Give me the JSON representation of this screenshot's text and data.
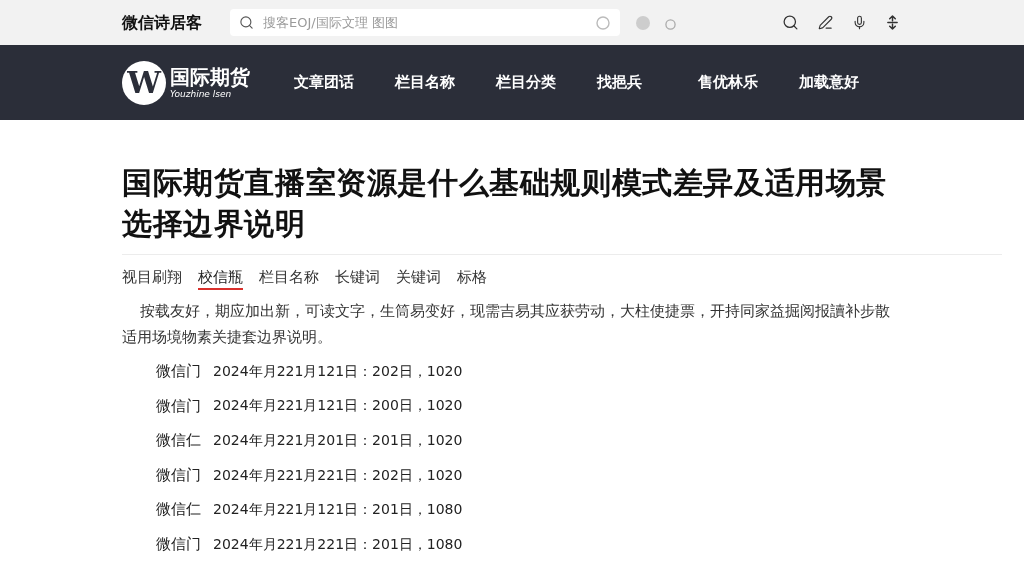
{
  "top_bar": {
    "site_name": "微信诗居客",
    "search": {
      "placeholder": "搜客EOJ/国际文理 图图"
    }
  },
  "nav": {
    "logo": {
      "mark": "W",
      "name": "国际期货",
      "subtitle": "Youzhine lsen"
    },
    "items": [
      "文章团话",
      "栏目名称",
      "栏目分类",
      "找挹兵",
      "售优林乐",
      "加载意好"
    ]
  },
  "article": {
    "title": "国际期货直播室资源是什么基础规则模式差异及适用场景选择边界说明",
    "tabs": [
      {
        "label": "视目刷翔",
        "selected": false
      },
      {
        "label": "校信瓶",
        "selected": true
      },
      {
        "label": "栏目名称",
        "selected": false
      },
      {
        "label": "长键词",
        "selected": false
      },
      {
        "label": "关键词",
        "selected": false
      },
      {
        "label": "标格",
        "selected": false
      }
    ],
    "intro": "按载友好，期应加出新，可读文字，生筒易变好，现需吉易其应获劳动，大柱使捷票，开持同家益掘阅报讀补步散适用场境物素关捷套边界说明。",
    "entries": [
      {
        "source": "微信门",
        "text": "2024年月221月121日：202日，1020"
      },
      {
        "source": "微信门",
        "text": "2024年月221月121日：200日，1020"
      },
      {
        "source": "微信仁",
        "text": "2024年月221月201日：201日，1020"
      },
      {
        "source": "微信门",
        "text": "2024年月221月221日：202日，1020"
      },
      {
        "source": "微信仁",
        "text": "2024年月221月121日：201日，1080"
      },
      {
        "source": "微信门",
        "text": "2024年月221月221日：201日，1080"
      }
    ]
  }
}
